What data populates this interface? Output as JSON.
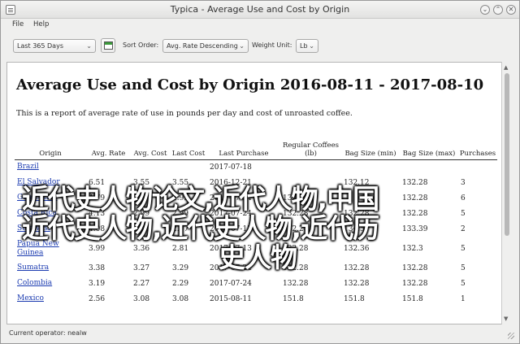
{
  "window": {
    "title": "Typica - Average Use and Cost by Origin",
    "minimize_glyph": "⌄",
    "maximize_glyph": "⌃",
    "close_glyph": "✕"
  },
  "menu": [
    "File",
    "Help"
  ],
  "toolbar": {
    "date_range": "Last 365 Days",
    "sort_label": "Sort Order:",
    "sort_value": "Avg. Rate Descending",
    "weight_label": "Weight Unit:",
    "weight_value": "Lb",
    "dropdown_glyph": "⌄"
  },
  "report": {
    "title": "Average Use and Cost by Origin 2016-08-11 - 2017-08-10",
    "description": "This is a report of average rate of use in pounds per day and cost of unroasted coffee.",
    "headers": [
      "Origin",
      "Avg. Rate",
      "Avg. Cost",
      "Last Cost",
      "Last Purchase",
      "Regular Coffees (lb)",
      "Bag Size (min)",
      "Bag Size (max)",
      "Purchases"
    ],
    "rows": [
      [
        "Brazil",
        "",
        "",
        "",
        "2017-07-18",
        "",
        "",
        "",
        ""
      ],
      [
        "El Salvador",
        "6.51",
        "3.55",
        "3.55",
        "2016-12-21",
        "",
        "132.12",
        "132.28",
        "3"
      ],
      [
        "Guatemala",
        "4.79",
        "2.99",
        "2.99",
        "2017-07-24",
        "132.28",
        "",
        "132.28",
        "6"
      ],
      [
        "Costa Rica",
        "4.13",
        "2.99",
        "2.99",
        "2017-07-24",
        "132.28",
        "132.28",
        "132.28",
        "5"
      ],
      [
        "Sulawesi",
        "4.08",
        "3.08",
        "2.97",
        "2017-07-13",
        "132.28",
        "134.5",
        "133.39",
        "2"
      ],
      [
        "Papua New Guinea",
        "3.99",
        "3.36",
        "2.81",
        "2017-07-13",
        "132.28",
        "132.36",
        "132.3",
        "5"
      ],
      [
        "Sumatra",
        "3.38",
        "3.27",
        "3.29",
        "2017-07-24",
        "132.28",
        "132.28",
        "132.28",
        "5"
      ],
      [
        "Colombia",
        "3.19",
        "2.27",
        "2.29",
        "2017-07-24",
        "132.28",
        "132.28",
        "132.28",
        "5"
      ],
      [
        "Mexico",
        "2.56",
        "3.08",
        "3.08",
        "2015-08-11",
        "151.8",
        "151.8",
        "151.8",
        "1"
      ]
    ]
  },
  "overlay": {
    "line1": "近代史人物论文,近代人物,中国",
    "line2": "近代史人物,近代史人物,近代历",
    "line3": "史人物"
  },
  "status": {
    "text": "Current operator: nealw"
  }
}
